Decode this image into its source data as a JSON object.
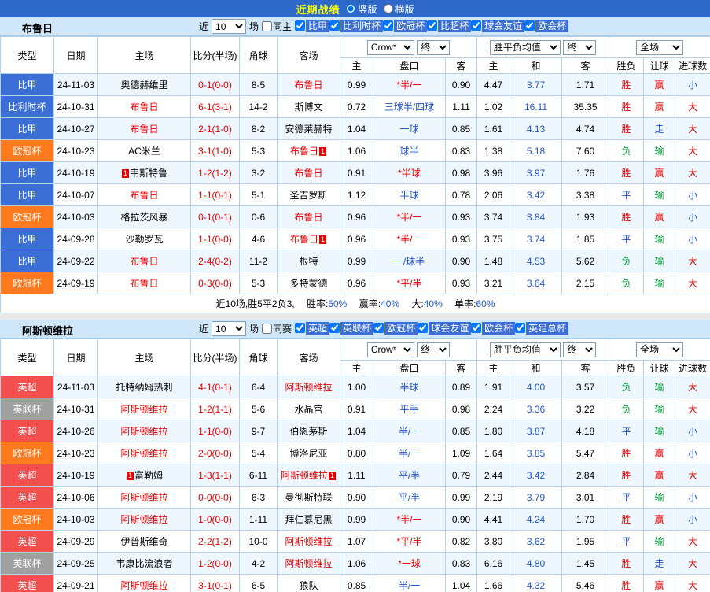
{
  "topbar": {
    "title": "近期战绩",
    "portrait": "竖版",
    "landscape": "横版"
  },
  "colors": {
    "league": {
      "比甲": "#3b6fd6",
      "比利时杯": "#3b6fd6",
      "欧冠杯": "#ff7a1e",
      "比超杯": "#3b6fd6",
      "英超": "#f34f4f",
      "英联杯": "#a0a0a0"
    },
    "handicap_receive": "#e60000",
    "handicap_give": "#2255cc",
    "outcome": {
      "胜": "#e60000",
      "平": "#2255cc",
      "负": "#009933",
      "赢": "#e60000",
      "走": "#2255cc",
      "输": "#009933",
      "大": "#e60000",
      "小": "#2255cc"
    },
    "focus_team": "#e60000",
    "score": "#e60000"
  },
  "headers": {
    "type": "类型",
    "date": "日期",
    "home": "主场",
    "score": "比分(半场)",
    "corner": "角球",
    "away": "客场",
    "home_odds": "主",
    "handicap": "盘口",
    "away_odds": "客",
    "win": "主",
    "draw": "和",
    "lose": "客",
    "result": "胜负",
    "handicap_result": "让球",
    "goals": "进球数"
  },
  "controls": {
    "bookmaker": "Crow*",
    "final1": "终",
    "europe": "胜平负均值",
    "final2": "终",
    "scope": "全场"
  },
  "sections": [
    {
      "team": "布鲁日",
      "filter": {
        "recent_label": "近",
        "recent_value": "10",
        "unit_label": "场",
        "same_label": "同主",
        "competitions": [
          "比甲",
          "比利时杯",
          "欧冠杯",
          "比超杯",
          "球会友谊",
          "欧会杯"
        ]
      },
      "rows": [
        {
          "league": "比甲",
          "date": "24-11-03",
          "home": {
            "name": "奥德赫维里"
          },
          "score": "0-1(0-0)",
          "corner": "8-5",
          "away": {
            "name": "布鲁日",
            "focus": true
          },
          "ah_home": "0.99",
          "handicap": "*半/一",
          "ah_away": "0.90",
          "win": "4.47",
          "draw": "3.77",
          "lose": "1.71",
          "result": "胜",
          "ah_result": "赢",
          "goal": "小"
        },
        {
          "league": "比利时杯",
          "date": "24-10-31",
          "home": {
            "name": "布鲁日",
            "focus": true
          },
          "score": "6-1(3-1)",
          "corner": "14-2",
          "away": {
            "name": "斯博文"
          },
          "ah_home": "0.72",
          "handicap": "三球半/四球",
          "ah_away": "1.11",
          "win": "1.02",
          "draw": "16.11",
          "lose": "35.35",
          "result": "胜",
          "ah_result": "赢",
          "goal": "大"
        },
        {
          "league": "比甲",
          "date": "24-10-27",
          "home": {
            "name": "布鲁日",
            "focus": true
          },
          "score": "2-1(1-0)",
          "corner": "8-2",
          "away": {
            "name": "安德莱赫特"
          },
          "ah_home": "1.04",
          "handicap": "一球",
          "ah_away": "0.85",
          "win": "1.61",
          "draw": "4.13",
          "lose": "4.74",
          "result": "胜",
          "ah_result": "走",
          "goal": "大"
        },
        {
          "league": "欧冠杯",
          "date": "24-10-23",
          "home": {
            "name": "AC米兰"
          },
          "score": "3-1(1-0)",
          "corner": "5-3",
          "away": {
            "name": "布鲁日",
            "focus": true,
            "badge": "1"
          },
          "ah_home": "1.06",
          "handicap": "球半",
          "ah_away": "0.83",
          "win": "1.38",
          "draw": "5.18",
          "lose": "7.60",
          "result": "负",
          "ah_result": "输",
          "goal": "大"
        },
        {
          "league": "比甲",
          "date": "24-10-19",
          "home": {
            "name": "韦斯特鲁",
            "badge": "1"
          },
          "score": "1-2(1-2)",
          "corner": "3-2",
          "away": {
            "name": "布鲁日",
            "focus": true
          },
          "ah_home": "0.91",
          "handicap": "*半球",
          "ah_away": "0.98",
          "win": "3.96",
          "draw": "3.97",
          "lose": "1.76",
          "result": "胜",
          "ah_result": "赢",
          "goal": "大"
        },
        {
          "league": "比甲",
          "date": "24-10-07",
          "home": {
            "name": "布鲁日",
            "focus": true
          },
          "score": "1-1(0-1)",
          "corner": "5-1",
          "away": {
            "name": "圣吉罗斯"
          },
          "ah_home": "1.12",
          "handicap": "半球",
          "ah_away": "0.78",
          "win": "2.06",
          "draw": "3.42",
          "lose": "3.38",
          "result": "平",
          "ah_result": "输",
          "goal": "小"
        },
        {
          "league": "欧冠杯",
          "date": "24-10-03",
          "home": {
            "name": "格拉茨风暴"
          },
          "score": "0-1(0-1)",
          "corner": "0-6",
          "away": {
            "name": "布鲁日",
            "focus": true
          },
          "ah_home": "0.96",
          "handicap": "*半/一",
          "ah_away": "0.93",
          "win": "3.74",
          "draw": "3.84",
          "lose": "1.93",
          "result": "胜",
          "ah_result": "赢",
          "goal": "小"
        },
        {
          "league": "比甲",
          "date": "24-09-28",
          "home": {
            "name": "沙勒罗瓦"
          },
          "score": "1-1(0-0)",
          "corner": "4-6",
          "away": {
            "name": "布鲁日",
            "focus": true,
            "badge": "1"
          },
          "ah_home": "0.96",
          "handicap": "*半/一",
          "ah_away": "0.93",
          "win": "3.75",
          "draw": "3.74",
          "lose": "1.85",
          "result": "平",
          "ah_result": "输",
          "goal": "小"
        },
        {
          "league": "比甲",
          "date": "24-09-22",
          "home": {
            "name": "布鲁日",
            "focus": true
          },
          "score": "2-4(0-2)",
          "corner": "11-2",
          "away": {
            "name": "根特"
          },
          "ah_home": "0.99",
          "handicap": "一/球半",
          "ah_away": "0.90",
          "win": "1.48",
          "draw": "4.53",
          "lose": "5.62",
          "result": "负",
          "ah_result": "输",
          "goal": "大"
        },
        {
          "league": "欧冠杯",
          "date": "24-09-19",
          "home": {
            "name": "布鲁日",
            "focus": true
          },
          "score": "0-3(0-0)",
          "corner": "5-3",
          "away": {
            "name": "多特蒙德"
          },
          "ah_home": "0.96",
          "handicap": "*平/半",
          "ah_away": "0.93",
          "win": "3.21",
          "draw": "3.64",
          "lose": "2.15",
          "result": "负",
          "ah_result": "输",
          "goal": "大"
        }
      ],
      "summary": {
        "text": "近10场,胜5平2负3,",
        "stats": [
          {
            "label": "胜率:",
            "value": "50%"
          },
          {
            "label": "赢率:",
            "value": "40%"
          },
          {
            "label": "大:",
            "value": "40%"
          },
          {
            "label": "单率:",
            "value": "60%"
          }
        ]
      }
    },
    {
      "team": "阿斯顿维拉",
      "filter": {
        "recent_label": "近",
        "recent_value": "10",
        "unit_label": "场",
        "same_label": "同赛",
        "competitions": [
          "英超",
          "英联杯",
          "欧冠杯",
          "球会友谊",
          "欧会杯",
          "英足总杯"
        ]
      },
      "rows": [
        {
          "league": "英超",
          "date": "24-11-03",
          "home": {
            "name": "托特纳姆热刺"
          },
          "score": "4-1(0-1)",
          "corner": "6-4",
          "away": {
            "name": "阿斯顿维拉",
            "focus": true
          },
          "ah_home": "1.00",
          "handicap": "半球",
          "ah_away": "0.89",
          "win": "1.91",
          "draw": "4.00",
          "lose": "3.57",
          "result": "负",
          "ah_result": "输",
          "goal": "大"
        },
        {
          "league": "英联杯",
          "date": "24-10-31",
          "home": {
            "name": "阿斯顿维拉",
            "focus": true
          },
          "score": "1-2(1-1)",
          "corner": "5-6",
          "away": {
            "name": "水晶宫"
          },
          "ah_home": "0.91",
          "handicap": "平手",
          "ah_away": "0.98",
          "win": "2.24",
          "draw": "3.36",
          "lose": "3.22",
          "result": "负",
          "ah_result": "输",
          "goal": "大"
        },
        {
          "league": "英超",
          "date": "24-10-26",
          "home": {
            "name": "阿斯顿维拉",
            "focus": true
          },
          "score": "1-1(0-0)",
          "corner": "9-7",
          "away": {
            "name": "伯恩茅斯"
          },
          "ah_home": "1.04",
          "handicap": "半/一",
          "ah_away": "0.85",
          "win": "1.80",
          "draw": "3.87",
          "lose": "4.18",
          "result": "平",
          "ah_result": "输",
          "goal": "小"
        },
        {
          "league": "欧冠杯",
          "date": "24-10-23",
          "home": {
            "name": "阿斯顿维拉",
            "focus": true
          },
          "score": "2-0(0-0)",
          "corner": "5-4",
          "away": {
            "name": "博洛尼亚"
          },
          "ah_home": "0.80",
          "handicap": "半/一",
          "ah_away": "1.09",
          "win": "1.64",
          "draw": "3.85",
          "lose": "5.47",
          "result": "胜",
          "ah_result": "赢",
          "goal": "小"
        },
        {
          "league": "英超",
          "date": "24-10-19",
          "home": {
            "name": "富勒姆",
            "badge": "1"
          },
          "score": "1-3(1-1)",
          "corner": "6-11",
          "away": {
            "name": "阿斯顿维拉",
            "focus": true,
            "badge": "1"
          },
          "ah_home": "1.11",
          "handicap": "平/半",
          "ah_away": "0.79",
          "win": "2.44",
          "draw": "3.42",
          "lose": "2.84",
          "result": "胜",
          "ah_result": "赢",
          "goal": "大"
        },
        {
          "league": "英超",
          "date": "24-10-06",
          "home": {
            "name": "阿斯顿维拉",
            "focus": true
          },
          "score": "0-0(0-0)",
          "corner": "6-3",
          "away": {
            "name": "曼彻斯特联"
          },
          "ah_home": "0.90",
          "handicap": "平/半",
          "ah_away": "0.99",
          "win": "2.19",
          "draw": "3.79",
          "lose": "3.01",
          "result": "平",
          "ah_result": "输",
          "goal": "小"
        },
        {
          "league": "欧冠杯",
          "date": "24-10-03",
          "home": {
            "name": "阿斯顿维拉",
            "focus": true
          },
          "score": "1-0(0-0)",
          "corner": "1-11",
          "away": {
            "name": "拜仁慕尼黑"
          },
          "ah_home": "0.99",
          "handicap": "*半/一",
          "ah_away": "0.90",
          "win": "4.41",
          "draw": "4.24",
          "lose": "1.70",
          "result": "胜",
          "ah_result": "赢",
          "goal": "小"
        },
        {
          "league": "英超",
          "date": "24-09-29",
          "home": {
            "name": "伊普斯维奇"
          },
          "score": "2-2(1-2)",
          "corner": "10-0",
          "away": {
            "name": "阿斯顿维拉",
            "focus": true
          },
          "ah_home": "1.07",
          "handicap": "*平/半",
          "ah_away": "0.82",
          "win": "3.80",
          "draw": "3.62",
          "lose": "1.95",
          "result": "平",
          "ah_result": "输",
          "goal": "大"
        },
        {
          "league": "英联杯",
          "date": "24-09-25",
          "home": {
            "name": "韦康比流浪者"
          },
          "score": "1-2(0-0)",
          "corner": "4-2",
          "away": {
            "name": "阿斯顿维拉",
            "focus": true
          },
          "ah_home": "1.06",
          "handicap": "*一球",
          "ah_away": "0.83",
          "win": "6.16",
          "draw": "4.80",
          "lose": "1.45",
          "result": "胜",
          "ah_result": "走",
          "goal": "大"
        },
        {
          "league": "英超",
          "date": "24-09-21",
          "home": {
            "name": "阿斯顿维拉",
            "focus": true
          },
          "score": "3-1(0-1)",
          "corner": "6-5",
          "away": {
            "name": "狼队"
          },
          "ah_home": "0.85",
          "handicap": "半/一",
          "ah_away": "1.04",
          "win": "1.66",
          "draw": "4.32",
          "lose": "5.46",
          "result": "胜",
          "ah_result": "赢",
          "goal": "大"
        }
      ]
    }
  ]
}
